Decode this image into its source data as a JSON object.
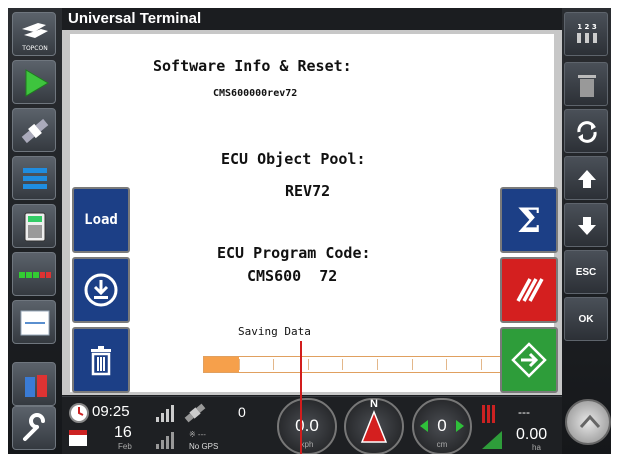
{
  "app": {
    "title": "Universal Terminal"
  },
  "left_rail": {
    "items": [
      {
        "icon": "topcon-logo-icon",
        "label": "TOPCON"
      },
      {
        "icon": "guidance-arrow-icon"
      },
      {
        "icon": "satellite-icon"
      },
      {
        "icon": "implement-layout-icon"
      },
      {
        "icon": "calculator-icon"
      },
      {
        "icon": "section-bar-icon"
      },
      {
        "icon": "isobus-terminal-icon"
      },
      {
        "icon": "fuel-can-icon"
      },
      {
        "icon": "wrench-icon"
      }
    ]
  },
  "mask": {
    "heading": "Software Info & Reset:",
    "software_version": "CMS600000rev72",
    "object_pool_label": "ECU Object Pool:",
    "object_pool_value": "REV72",
    "program_code_label": "ECU Program Code:",
    "program_code_value": "CMS600  72",
    "status_text": "Saving Data",
    "progress": 0.1
  },
  "soft_keys": {
    "load_label": "Load",
    "download_icon": "download-icon",
    "delete_icon": "trash-icon",
    "sigma_icon": "sigma-icon",
    "slash_icon": "triple-slash-icon",
    "enter_icon": "enter-arrow-icon"
  },
  "right_rail": {
    "items": [
      {
        "icon": "counters-icon",
        "label": "1 2 3"
      },
      {
        "icon": "trash-bin-icon"
      },
      {
        "icon": "refresh-icon"
      },
      {
        "icon": "arrow-up-icon"
      },
      {
        "icon": "arrow-down-icon"
      },
      {
        "label": "ESC"
      },
      {
        "label": "OK"
      }
    ]
  },
  "status_bar": {
    "time": "09:25",
    "date_day": "16",
    "date_month": "Feb",
    "satellites": "0",
    "gps_status": "No GPS",
    "speed_value": "0.0",
    "speed_unit": "kph",
    "compass_heading": "N",
    "offset_value": "0",
    "offset_unit": "cm",
    "area_top": "---",
    "area_value": "0.00",
    "area_unit": "ha"
  },
  "colors": {
    "softkey_blue": "#1c3f86",
    "softkey_red": "#d41f1f",
    "softkey_green": "#2e9d3a",
    "progress_fill": "#f6a04b"
  }
}
